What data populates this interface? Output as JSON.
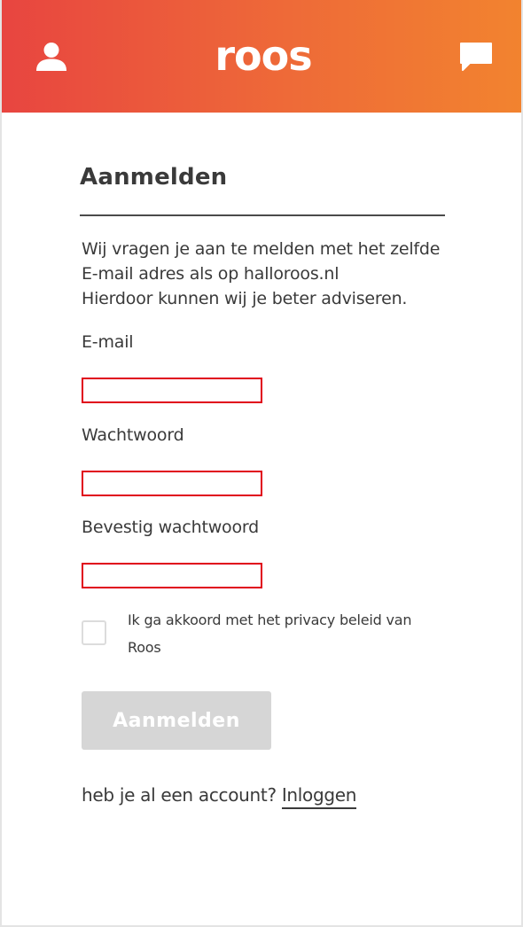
{
  "header": {
    "logo_text": "roos",
    "user_icon": "user-icon",
    "chat_icon": "chat-icon",
    "gradient_start": "#e84540",
    "gradient_end": "#f2832f"
  },
  "form": {
    "title": "Aanmelden",
    "intro_lines": [
      "Wij vragen je aan te melden met het zelfde",
      "E-mail adres als op halloroos.nl",
      "Hierdoor kunnen wij je beter adviseren."
    ],
    "email_label": "E-mail",
    "email_value": "",
    "password_label": "Wachtwoord",
    "password_value": "",
    "confirm_label": "Bevestig wachtwoord",
    "confirm_value": "",
    "error_border_color": "#e0001b",
    "privacy_label": "Ik ga akkoord met het privacy beleid van Roos",
    "privacy_checked": false,
    "submit_label": "Aanmelden",
    "submit_disabled": true,
    "account_prompt": "heb je al een account?",
    "login_link": "Inloggen"
  }
}
